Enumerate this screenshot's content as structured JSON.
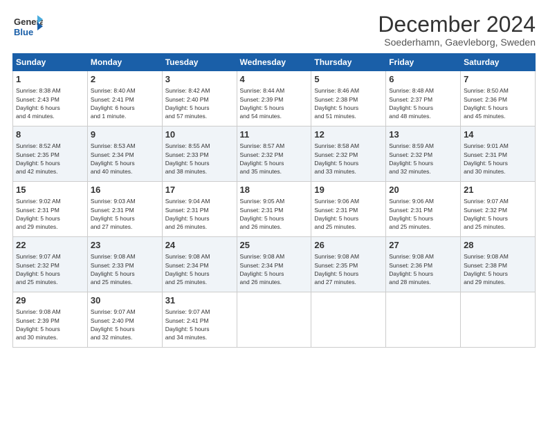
{
  "header": {
    "logo_general": "General",
    "logo_blue": "Blue",
    "title": "December 2024",
    "subtitle": "Soederhamn, Gaevleborg, Sweden"
  },
  "columns": [
    "Sunday",
    "Monday",
    "Tuesday",
    "Wednesday",
    "Thursday",
    "Friday",
    "Saturday"
  ],
  "weeks": [
    [
      {
        "day": "1",
        "info": "Sunrise: 8:38 AM\nSunset: 2:43 PM\nDaylight: 6 hours\nand 4 minutes."
      },
      {
        "day": "2",
        "info": "Sunrise: 8:40 AM\nSunset: 2:41 PM\nDaylight: 6 hours\nand 1 minute."
      },
      {
        "day": "3",
        "info": "Sunrise: 8:42 AM\nSunset: 2:40 PM\nDaylight: 5 hours\nand 57 minutes."
      },
      {
        "day": "4",
        "info": "Sunrise: 8:44 AM\nSunset: 2:39 PM\nDaylight: 5 hours\nand 54 minutes."
      },
      {
        "day": "5",
        "info": "Sunrise: 8:46 AM\nSunset: 2:38 PM\nDaylight: 5 hours\nand 51 minutes."
      },
      {
        "day": "6",
        "info": "Sunrise: 8:48 AM\nSunset: 2:37 PM\nDaylight: 5 hours\nand 48 minutes."
      },
      {
        "day": "7",
        "info": "Sunrise: 8:50 AM\nSunset: 2:36 PM\nDaylight: 5 hours\nand 45 minutes."
      }
    ],
    [
      {
        "day": "8",
        "info": "Sunrise: 8:52 AM\nSunset: 2:35 PM\nDaylight: 5 hours\nand 42 minutes."
      },
      {
        "day": "9",
        "info": "Sunrise: 8:53 AM\nSunset: 2:34 PM\nDaylight: 5 hours\nand 40 minutes."
      },
      {
        "day": "10",
        "info": "Sunrise: 8:55 AM\nSunset: 2:33 PM\nDaylight: 5 hours\nand 38 minutes."
      },
      {
        "day": "11",
        "info": "Sunrise: 8:57 AM\nSunset: 2:32 PM\nDaylight: 5 hours\nand 35 minutes."
      },
      {
        "day": "12",
        "info": "Sunrise: 8:58 AM\nSunset: 2:32 PM\nDaylight: 5 hours\nand 33 minutes."
      },
      {
        "day": "13",
        "info": "Sunrise: 8:59 AM\nSunset: 2:32 PM\nDaylight: 5 hours\nand 32 minutes."
      },
      {
        "day": "14",
        "info": "Sunrise: 9:01 AM\nSunset: 2:31 PM\nDaylight: 5 hours\nand 30 minutes."
      }
    ],
    [
      {
        "day": "15",
        "info": "Sunrise: 9:02 AM\nSunset: 2:31 PM\nDaylight: 5 hours\nand 29 minutes."
      },
      {
        "day": "16",
        "info": "Sunrise: 9:03 AM\nSunset: 2:31 PM\nDaylight: 5 hours\nand 27 minutes."
      },
      {
        "day": "17",
        "info": "Sunrise: 9:04 AM\nSunset: 2:31 PM\nDaylight: 5 hours\nand 26 minutes."
      },
      {
        "day": "18",
        "info": "Sunrise: 9:05 AM\nSunset: 2:31 PM\nDaylight: 5 hours\nand 26 minutes."
      },
      {
        "day": "19",
        "info": "Sunrise: 9:06 AM\nSunset: 2:31 PM\nDaylight: 5 hours\nand 25 minutes."
      },
      {
        "day": "20",
        "info": "Sunrise: 9:06 AM\nSunset: 2:31 PM\nDaylight: 5 hours\nand 25 minutes."
      },
      {
        "day": "21",
        "info": "Sunrise: 9:07 AM\nSunset: 2:32 PM\nDaylight: 5 hours\nand 25 minutes."
      }
    ],
    [
      {
        "day": "22",
        "info": "Sunrise: 9:07 AM\nSunset: 2:32 PM\nDaylight: 5 hours\nand 25 minutes."
      },
      {
        "day": "23",
        "info": "Sunrise: 9:08 AM\nSunset: 2:33 PM\nDaylight: 5 hours\nand 25 minutes."
      },
      {
        "day": "24",
        "info": "Sunrise: 9:08 AM\nSunset: 2:34 PM\nDaylight: 5 hours\nand 25 minutes."
      },
      {
        "day": "25",
        "info": "Sunrise: 9:08 AM\nSunset: 2:34 PM\nDaylight: 5 hours\nand 26 minutes."
      },
      {
        "day": "26",
        "info": "Sunrise: 9:08 AM\nSunset: 2:35 PM\nDaylight: 5 hours\nand 27 minutes."
      },
      {
        "day": "27",
        "info": "Sunrise: 9:08 AM\nSunset: 2:36 PM\nDaylight: 5 hours\nand 28 minutes."
      },
      {
        "day": "28",
        "info": "Sunrise: 9:08 AM\nSunset: 2:38 PM\nDaylight: 5 hours\nand 29 minutes."
      }
    ],
    [
      {
        "day": "29",
        "info": "Sunrise: 9:08 AM\nSunset: 2:39 PM\nDaylight: 5 hours\nand 30 minutes."
      },
      {
        "day": "30",
        "info": "Sunrise: 9:07 AM\nSunset: 2:40 PM\nDaylight: 5 hours\nand 32 minutes."
      },
      {
        "day": "31",
        "info": "Sunrise: 9:07 AM\nSunset: 2:41 PM\nDaylight: 5 hours\nand 34 minutes."
      },
      {
        "day": "",
        "info": ""
      },
      {
        "day": "",
        "info": ""
      },
      {
        "day": "",
        "info": ""
      },
      {
        "day": "",
        "info": ""
      }
    ]
  ]
}
